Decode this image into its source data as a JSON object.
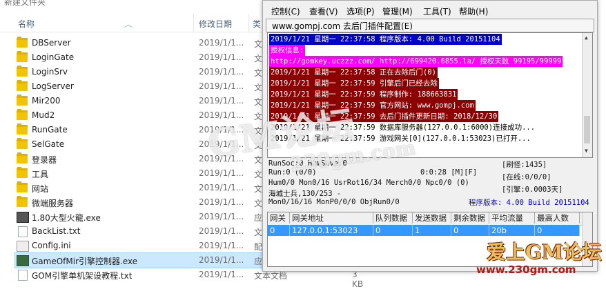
{
  "explorer": {
    "window_title": "新建文件夹",
    "columns": {
      "name": "名称",
      "date": "修改日期",
      "type": "类"
    },
    "rows": [
      {
        "name": "DBServer",
        "date": "2019/1/1...",
        "type": "文",
        "icon": "folder-icon"
      },
      {
        "name": "LoginGate",
        "date": "2019/1/1...",
        "type": "文",
        "icon": "folder-icon"
      },
      {
        "name": "LoginSrv",
        "date": "2019/1/1...",
        "type": "文",
        "icon": "folder-icon"
      },
      {
        "name": "LogServer",
        "date": "2019/1/1...",
        "type": "文",
        "icon": "folder-icon"
      },
      {
        "name": "Mir200",
        "date": "2019/1/1...",
        "type": "文",
        "icon": "folder-icon"
      },
      {
        "name": "Mud2",
        "date": "2019/1/1...",
        "type": "文",
        "icon": "folder-icon"
      },
      {
        "name": "RunGate",
        "date": "2019/1/1...",
        "type": "文",
        "icon": "folder-icon"
      },
      {
        "name": "SelGate",
        "date": "2019/1/1...",
        "type": "文",
        "icon": "folder-icon"
      },
      {
        "name": "登录器",
        "date": "2019/1/1...",
        "type": "文",
        "icon": "folder-icon"
      },
      {
        "name": "工具",
        "date": "2019/1/1...",
        "type": "文",
        "icon": "folder-icon"
      },
      {
        "name": "网站",
        "date": "2019/1/1...",
        "type": "文",
        "icon": "folder-icon"
      },
      {
        "name": "微端服务器",
        "date": "2019/1/1...",
        "type": "文",
        "icon": "folder-icon"
      },
      {
        "name": "1.80大型火龍.exe",
        "date": "2019/1/1...",
        "type": "应",
        "icon": "exe-icon"
      },
      {
        "name": "BackList.txt",
        "date": "2019/1/1...",
        "type": "文",
        "icon": "text-file-icon"
      },
      {
        "name": "Config.ini",
        "date": "2019/1/1...",
        "type": "配",
        "icon": "config-file-icon"
      },
      {
        "name": "GameOfMir引擎控制器.exe",
        "date": "2019/1/1...",
        "type": "应",
        "icon": "game-exe-icon",
        "selected": true
      },
      {
        "name": "GOM引擎单机架设教程.txt",
        "date": "2019/1/1...",
        "type": "文本文档",
        "size": "3 KB",
        "icon": "text-file-icon"
      }
    ]
  },
  "app": {
    "menu": [
      "控制(C)",
      "查看(V)",
      "选项(P)",
      "管理(M)",
      "工具(T)",
      "帮助(H)"
    ],
    "plugin_label": "www.gompj.com 去后门插件配置(E)",
    "log": [
      {
        "text": "2019/1/21 星期一 22:37:58 程序版本: 4.00 Build 20151104",
        "bg": "#0000c8",
        "fg": "#ffffff"
      },
      {
        "text": "授权信息:",
        "bg": "#ff00ff",
        "fg": "#ffffff"
      },
      {
        "text": "http://gomkey.uczzz.com/ http://699420.6855.la/ 授权天数 99195/99999",
        "bg": "#ff00ff",
        "fg": "#ffffff"
      },
      {
        "text": "2019/1/21 星期一 22:37:58 正在去除后门(0)",
        "bg": "#8b0000",
        "fg": "#ffffff"
      },
      {
        "text": "2019/1/21 星期一 22:37:59 引擎后门已经去除",
        "bg": "#8b0000",
        "fg": "#ffffff"
      },
      {
        "text": "2019/1/21 星期一 22:37:59 程序制作: 188663831",
        "bg": "#8b0000",
        "fg": "#ffffff"
      },
      {
        "text": "2019/1/21 星期一 22:37:59 官方网站: www.gompj.com",
        "bg": "#8b0000",
        "fg": "#ffffff"
      },
      {
        "text": "2019/1/21 星期一 22:37:59 去后门插件更新日期: 2018/12/30",
        "bg": "#8b0000",
        "fg": "#ffffff"
      },
      {
        "text": "2019/1/21 星期一 22:37:59 数据库服务器(127.0.0.1:6000)连接成功...",
        "bg": "#ffffff",
        "fg": "#000000"
      },
      {
        "text": "2019/1/21 星期一 22:37:59 游戏网关[0](127.0.0.1:53023)已打开...",
        "bg": "#ffffff",
        "fg": "#000000"
      }
    ],
    "status": {
      "line1": "RunSoc:0 HumSave:0",
      "line2": "Run:0 (0/0)",
      "line2b": "0:0:28 [M][F]",
      "line3": "Hum0/0 Mon0/16 UsrRot16/34 Merch0/0 Npc0/0 (0)",
      "line4": "海城士兵,130/253 -",
      "line5": "Mon0/16/16 MonP0/0/0 ObjRun0/0",
      "refresh": "[刷怪:1435]",
      "online": "[在线:0/0/0]",
      "engine": "[引擎:0.0003天]",
      "version": "程序版本: 4.00 Build 20151104"
    },
    "grid": {
      "headers": [
        "网关",
        "网关地址",
        "队列数据",
        "发送数据",
        "剩余数据",
        "平均流量",
        "最高人数"
      ],
      "rows": [
        [
          "0",
          "127.0.0.1:53023",
          "0",
          "1",
          "0",
          "20b",
          "0"
        ]
      ]
    }
  },
  "watermarks": {
    "large": "GM论坛",
    "mid": "230gm.com",
    "logo": "爱上GM论坛",
    "url": "www.230gm.com"
  },
  "colors": {
    "selection": "#cce8ff",
    "grid_selection": "#3399ff",
    "version_text": "#0000c8"
  }
}
